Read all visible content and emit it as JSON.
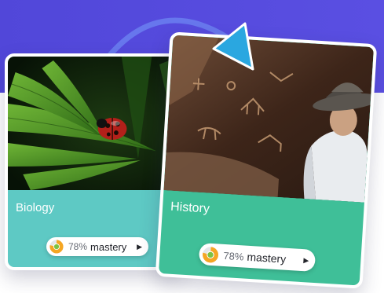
{
  "cards": [
    {
      "subject": "Biology",
      "mastery_percent": "78%",
      "mastery_label": "mastery",
      "progress": 0.78,
      "play_icon": "▶"
    },
    {
      "subject": "History",
      "mastery_percent": "78%",
      "mastery_label": "mastery",
      "progress": 0.78,
      "play_icon": "▶"
    }
  ],
  "colors": {
    "band": "#5147d9",
    "biology_card": "#5ec9c4",
    "history_card": "#3fbf98",
    "arrow": "#2aa7e0",
    "ring_green": "#7cc243",
    "ring_orange": "#f5a623",
    "ring_track": "#e4e6ea"
  }
}
